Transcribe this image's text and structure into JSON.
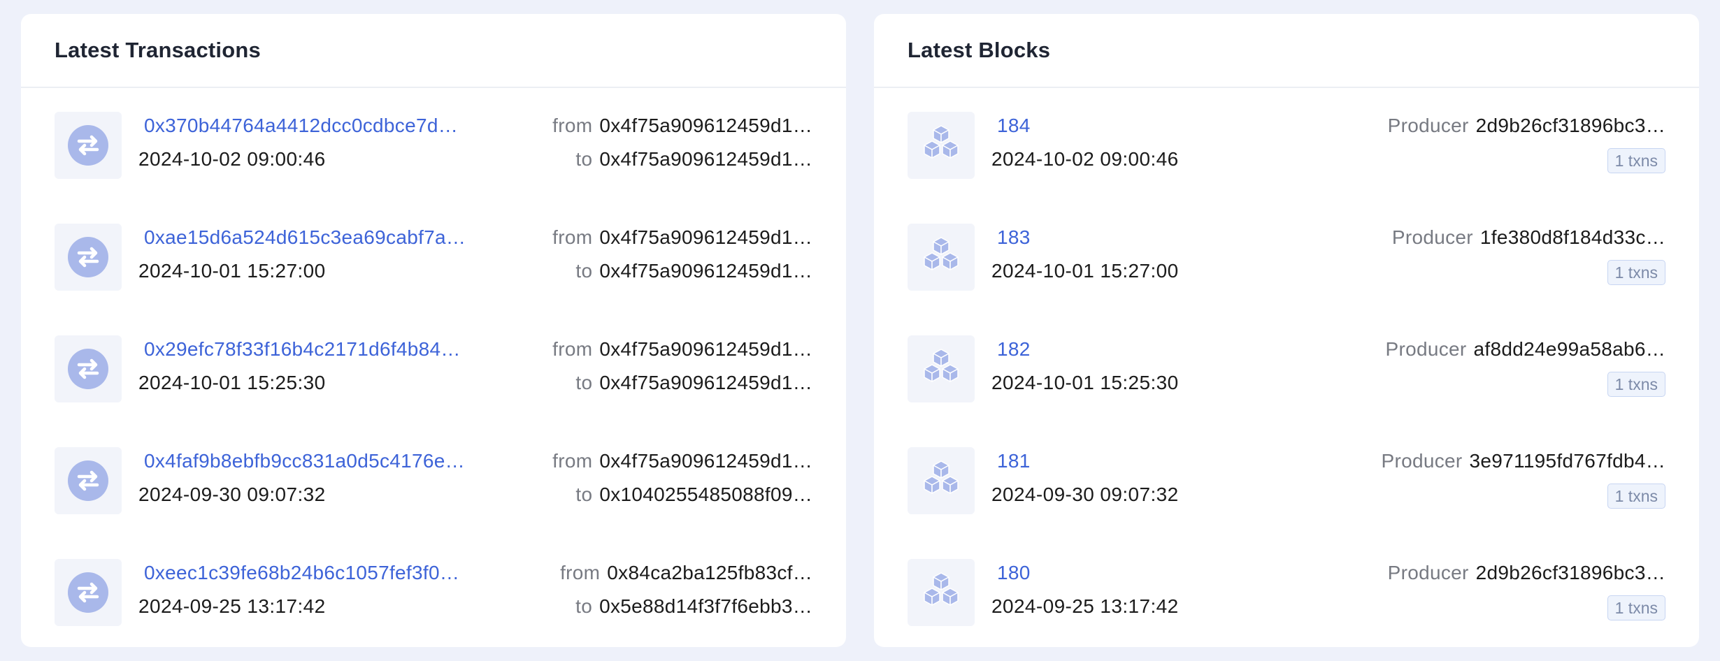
{
  "transactions": {
    "title": "Latest Transactions",
    "from_label": "from",
    "to_label": "to",
    "items": [
      {
        "hash": "0x370b44764a4412dcc0cdbce7d…",
        "time": "2024-10-02 09:00:46",
        "from": "0x4f75a909612459d1…",
        "to": "0x4f75a909612459d1…"
      },
      {
        "hash": "0xae15d6a524d615c3ea69cabf7a…",
        "time": "2024-10-01 15:27:00",
        "from": "0x4f75a909612459d1…",
        "to": "0x4f75a909612459d1…"
      },
      {
        "hash": "0x29efc78f33f16b4c2171d6f4b84…",
        "time": "2024-10-01 15:25:30",
        "from": "0x4f75a909612459d1…",
        "to": "0x4f75a909612459d1…"
      },
      {
        "hash": "0x4faf9b8ebfb9cc831a0d5c4176e…",
        "time": "2024-09-30 09:07:32",
        "from": "0x4f75a909612459d1…",
        "to": "0x1040255485088f09…"
      },
      {
        "hash": "0xeec1c39fe68b24b6c1057fef3f0…",
        "time": "2024-09-25 13:17:42",
        "from": "0x84ca2ba125fb83cf…",
        "to": "0x5e88d14f3f7f6ebb3…"
      }
    ]
  },
  "blocks": {
    "title": "Latest Blocks",
    "producer_label": "Producer",
    "items": [
      {
        "number": "184",
        "time": "2024-10-02 09:00:46",
        "producer": "2d9b26cf31896bc3…",
        "txns": "1 txns"
      },
      {
        "number": "183",
        "time": "2024-10-01 15:27:00",
        "producer": "1fe380d8f184d33c…",
        "txns": "1 txns"
      },
      {
        "number": "182",
        "time": "2024-10-01 15:25:30",
        "producer": "af8dd24e99a58ab6…",
        "txns": "1 txns"
      },
      {
        "number": "181",
        "time": "2024-09-30 09:07:32",
        "producer": "3e971195fd767fdb4…",
        "txns": "1 txns"
      },
      {
        "number": "180",
        "time": "2024-09-25 13:17:42",
        "producer": "2d9b26cf31896bc3…",
        "txns": "1 txns"
      }
    ]
  },
  "icons": {
    "transaction": "swap-arrows-icon",
    "block": "cubes-icon"
  },
  "colors": {
    "link": "#3d63d8",
    "icon_fill": "#a9b8ea",
    "page_bg": "#eef1fa",
    "badge_bg": "#eef3fc",
    "badge_border": "#c7d5f2"
  }
}
